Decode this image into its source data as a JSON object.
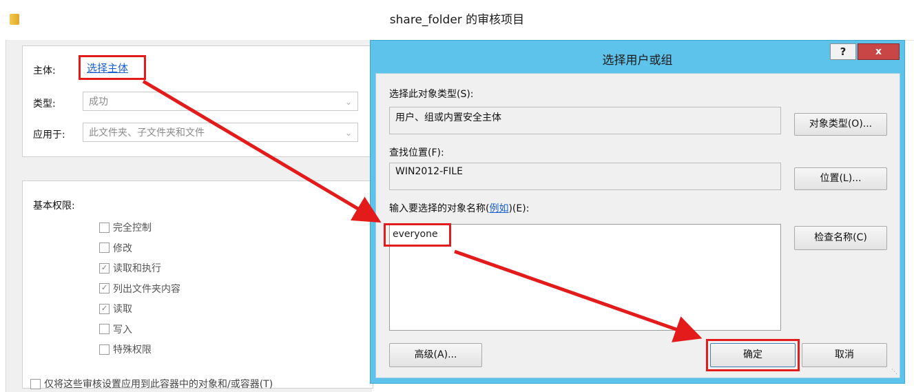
{
  "outer_window": {
    "title": "share_folder 的审核项目"
  },
  "audit_entry": {
    "principal_label": "主体:",
    "principal_link": "选择主体",
    "type_label": "类型:",
    "type_value": "成功",
    "applies_to_label": "应用于:",
    "applies_to_value": "此文件夹、子文件夹和文件"
  },
  "basic_permissions": {
    "heading": "基本权限:",
    "items": [
      {
        "label": "完全控制",
        "checked": false
      },
      {
        "label": "修改",
        "checked": false
      },
      {
        "label": "读取和执行",
        "checked": true
      },
      {
        "label": "列出文件夹内容",
        "checked": true
      },
      {
        "label": "读取",
        "checked": true
      },
      {
        "label": "写入",
        "checked": false
      },
      {
        "label": "特殊权限",
        "checked": false
      }
    ],
    "apply_only_label": "仅将这些审核设置应用到此容器中的对象和/或容器(T)"
  },
  "dialog": {
    "title": "选择用户或组",
    "help_glyph": "?",
    "close_glyph": "x",
    "object_type_label": "选择此对象类型(S):",
    "object_type_value": "用户、组或内置安全主体",
    "object_type_button": "对象类型(O)...",
    "location_label": "查找位置(F):",
    "location_value": "WIN2012-FILE",
    "location_button": "位置(L)...",
    "names_label_prefix": "输入要选择的对象名称(",
    "names_label_link": "例如",
    "names_label_suffix": ")(E):",
    "names_value": "everyone",
    "check_names_button": "检查名称(C)",
    "advanced_button": "高级(A)...",
    "ok_button": "确定",
    "cancel_button": "取消"
  },
  "annotation_colors": {
    "highlight": "#e31b1b"
  },
  "icons": [
    "folder-icon",
    "chevron-down-icon",
    "checkbox-icon",
    "help-icon",
    "close-icon",
    "resize-grip-icon"
  ]
}
